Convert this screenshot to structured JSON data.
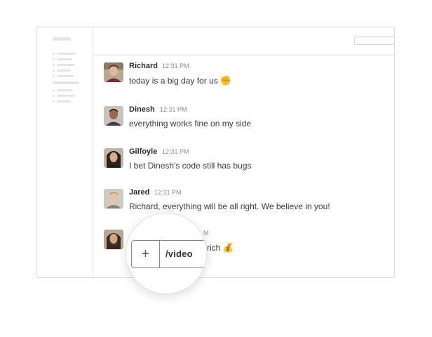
{
  "messages": [
    {
      "author": "Richard",
      "time": "12:31 PM",
      "text": "today is a big day for us",
      "emoji": "✊"
    },
    {
      "author": "Dinesh",
      "time": "12:31 PM",
      "text": "everything works fine on my side"
    },
    {
      "author": "Gilfoyle",
      "time": "12:31 PM",
      "text": "I bet Dinesh's code still has bugs"
    },
    {
      "author": "Jared",
      "time": "12:31 PM",
      "text": "Richard, everything will be all right. We believe in you!"
    },
    {
      "time_fragment": "M",
      "text_fragment": "e rich",
      "emoji": "💰"
    }
  ],
  "composer": {
    "plus_label": "+",
    "input_value": "/video"
  },
  "colors": {
    "border": "#dcdcdc",
    "placeholder_bar": "#e6e6e6",
    "author_text": "#2c2c2c",
    "time_text": "#8b8b8b"
  }
}
